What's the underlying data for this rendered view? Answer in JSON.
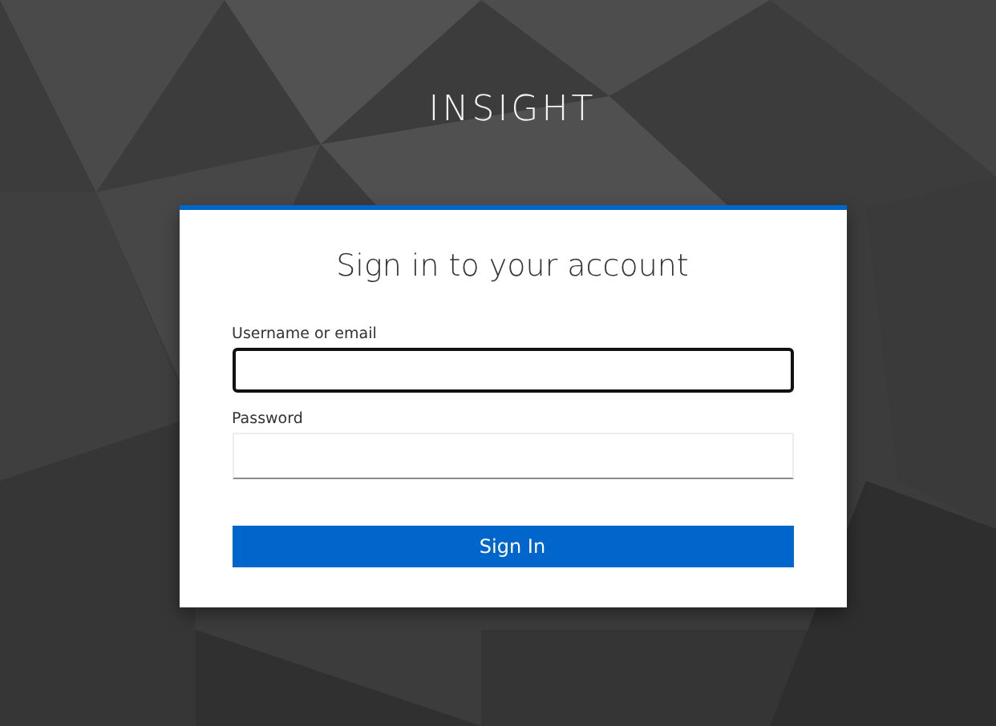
{
  "brand": {
    "title": "INSIGHT"
  },
  "login_card": {
    "heading": "Sign in to your account",
    "fields": [
      {
        "label": "Username or email",
        "focused": true
      },
      {
        "label": "Password",
        "focused": false
      }
    ],
    "submit_button": "Sign In"
  }
}
